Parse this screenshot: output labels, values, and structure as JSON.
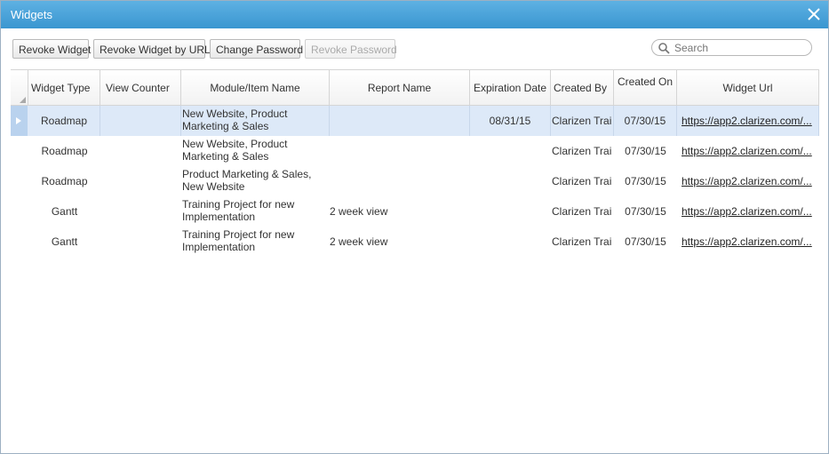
{
  "window": {
    "title": "Widgets"
  },
  "toolbar": {
    "revoke_widget": "Revoke Widget",
    "revoke_widget_by_url": "Revoke Widget by URL",
    "change_password": "Change Password",
    "revoke_password": "Revoke Password"
  },
  "search": {
    "placeholder": "Search"
  },
  "table": {
    "columns": [
      "Widget Type",
      "View Counter",
      "Module/Item Name",
      "Report Name",
      "Expiration Date",
      "Created By",
      "Created On",
      "Widget Url"
    ],
    "rows": [
      {
        "widget_type": "Roadmap",
        "view_counter": "",
        "module_item_name": "New Website, Product Marketing & Sales",
        "report_name": "",
        "expiration_date": "08/31/15",
        "created_by": "Clarizen Trai",
        "created_on": "07/30/15",
        "widget_url": "https://app2.clarizen.com/..."
      },
      {
        "widget_type": "Roadmap",
        "view_counter": "",
        "module_item_name": "New Website, Product Marketing & Sales",
        "report_name": "",
        "expiration_date": "",
        "created_by": "Clarizen Trai",
        "created_on": "07/30/15",
        "widget_url": "https://app2.clarizen.com/..."
      },
      {
        "widget_type": "Roadmap",
        "view_counter": "",
        "module_item_name": "Product Marketing & Sales, New Website",
        "report_name": "",
        "expiration_date": "",
        "created_by": "Clarizen Trai",
        "created_on": "07/30/15",
        "widget_url": "https://app2.clarizen.com/..."
      },
      {
        "widget_type": "Gantt",
        "view_counter": "",
        "module_item_name": "Training Project for new Implementation",
        "report_name": "2 week view",
        "expiration_date": "",
        "created_by": "Clarizen Trai",
        "created_on": "07/30/15",
        "widget_url": "https://app2.clarizen.com/..."
      },
      {
        "widget_type": "Gantt",
        "view_counter": "",
        "module_item_name": "Training Project for new Implementation",
        "report_name": "2 week view",
        "expiration_date": "",
        "created_by": "Clarizen Trai",
        "created_on": "07/30/15",
        "widget_url": "https://app2.clarizen.com/..."
      }
    ]
  },
  "colors": {
    "titlebar": "#3a96d0",
    "selected_row": "#dde9f8"
  },
  "icons": {
    "close": "close-icon",
    "search": "search-icon",
    "row_selector": "triangle-right-icon"
  }
}
